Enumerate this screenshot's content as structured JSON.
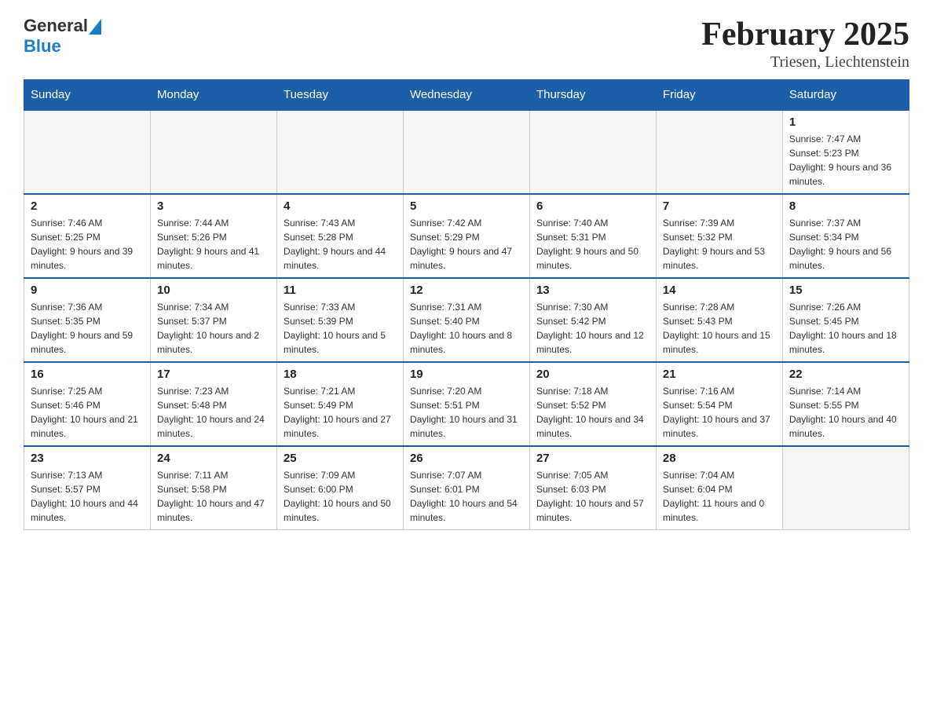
{
  "logo": {
    "general": "General",
    "blue": "Blue"
  },
  "title": "February 2025",
  "subtitle": "Triesen, Liechtenstein",
  "days_of_week": [
    "Sunday",
    "Monday",
    "Tuesday",
    "Wednesday",
    "Thursday",
    "Friday",
    "Saturday"
  ],
  "weeks": [
    {
      "days": [
        {
          "num": "",
          "info": ""
        },
        {
          "num": "",
          "info": ""
        },
        {
          "num": "",
          "info": ""
        },
        {
          "num": "",
          "info": ""
        },
        {
          "num": "",
          "info": ""
        },
        {
          "num": "",
          "info": ""
        },
        {
          "num": "1",
          "info": "Sunrise: 7:47 AM\nSunset: 5:23 PM\nDaylight: 9 hours and 36 minutes."
        }
      ]
    },
    {
      "days": [
        {
          "num": "2",
          "info": "Sunrise: 7:46 AM\nSunset: 5:25 PM\nDaylight: 9 hours and 39 minutes."
        },
        {
          "num": "3",
          "info": "Sunrise: 7:44 AM\nSunset: 5:26 PM\nDaylight: 9 hours and 41 minutes."
        },
        {
          "num": "4",
          "info": "Sunrise: 7:43 AM\nSunset: 5:28 PM\nDaylight: 9 hours and 44 minutes."
        },
        {
          "num": "5",
          "info": "Sunrise: 7:42 AM\nSunset: 5:29 PM\nDaylight: 9 hours and 47 minutes."
        },
        {
          "num": "6",
          "info": "Sunrise: 7:40 AM\nSunset: 5:31 PM\nDaylight: 9 hours and 50 minutes."
        },
        {
          "num": "7",
          "info": "Sunrise: 7:39 AM\nSunset: 5:32 PM\nDaylight: 9 hours and 53 minutes."
        },
        {
          "num": "8",
          "info": "Sunrise: 7:37 AM\nSunset: 5:34 PM\nDaylight: 9 hours and 56 minutes."
        }
      ]
    },
    {
      "days": [
        {
          "num": "9",
          "info": "Sunrise: 7:36 AM\nSunset: 5:35 PM\nDaylight: 9 hours and 59 minutes."
        },
        {
          "num": "10",
          "info": "Sunrise: 7:34 AM\nSunset: 5:37 PM\nDaylight: 10 hours and 2 minutes."
        },
        {
          "num": "11",
          "info": "Sunrise: 7:33 AM\nSunset: 5:39 PM\nDaylight: 10 hours and 5 minutes."
        },
        {
          "num": "12",
          "info": "Sunrise: 7:31 AM\nSunset: 5:40 PM\nDaylight: 10 hours and 8 minutes."
        },
        {
          "num": "13",
          "info": "Sunrise: 7:30 AM\nSunset: 5:42 PM\nDaylight: 10 hours and 12 minutes."
        },
        {
          "num": "14",
          "info": "Sunrise: 7:28 AM\nSunset: 5:43 PM\nDaylight: 10 hours and 15 minutes."
        },
        {
          "num": "15",
          "info": "Sunrise: 7:26 AM\nSunset: 5:45 PM\nDaylight: 10 hours and 18 minutes."
        }
      ]
    },
    {
      "days": [
        {
          "num": "16",
          "info": "Sunrise: 7:25 AM\nSunset: 5:46 PM\nDaylight: 10 hours and 21 minutes."
        },
        {
          "num": "17",
          "info": "Sunrise: 7:23 AM\nSunset: 5:48 PM\nDaylight: 10 hours and 24 minutes."
        },
        {
          "num": "18",
          "info": "Sunrise: 7:21 AM\nSunset: 5:49 PM\nDaylight: 10 hours and 27 minutes."
        },
        {
          "num": "19",
          "info": "Sunrise: 7:20 AM\nSunset: 5:51 PM\nDaylight: 10 hours and 31 minutes."
        },
        {
          "num": "20",
          "info": "Sunrise: 7:18 AM\nSunset: 5:52 PM\nDaylight: 10 hours and 34 minutes."
        },
        {
          "num": "21",
          "info": "Sunrise: 7:16 AM\nSunset: 5:54 PM\nDaylight: 10 hours and 37 minutes."
        },
        {
          "num": "22",
          "info": "Sunrise: 7:14 AM\nSunset: 5:55 PM\nDaylight: 10 hours and 40 minutes."
        }
      ]
    },
    {
      "days": [
        {
          "num": "23",
          "info": "Sunrise: 7:13 AM\nSunset: 5:57 PM\nDaylight: 10 hours and 44 minutes."
        },
        {
          "num": "24",
          "info": "Sunrise: 7:11 AM\nSunset: 5:58 PM\nDaylight: 10 hours and 47 minutes."
        },
        {
          "num": "25",
          "info": "Sunrise: 7:09 AM\nSunset: 6:00 PM\nDaylight: 10 hours and 50 minutes."
        },
        {
          "num": "26",
          "info": "Sunrise: 7:07 AM\nSunset: 6:01 PM\nDaylight: 10 hours and 54 minutes."
        },
        {
          "num": "27",
          "info": "Sunrise: 7:05 AM\nSunset: 6:03 PM\nDaylight: 10 hours and 57 minutes."
        },
        {
          "num": "28",
          "info": "Sunrise: 7:04 AM\nSunset: 6:04 PM\nDaylight: 11 hours and 0 minutes."
        },
        {
          "num": "",
          "info": ""
        }
      ]
    }
  ]
}
